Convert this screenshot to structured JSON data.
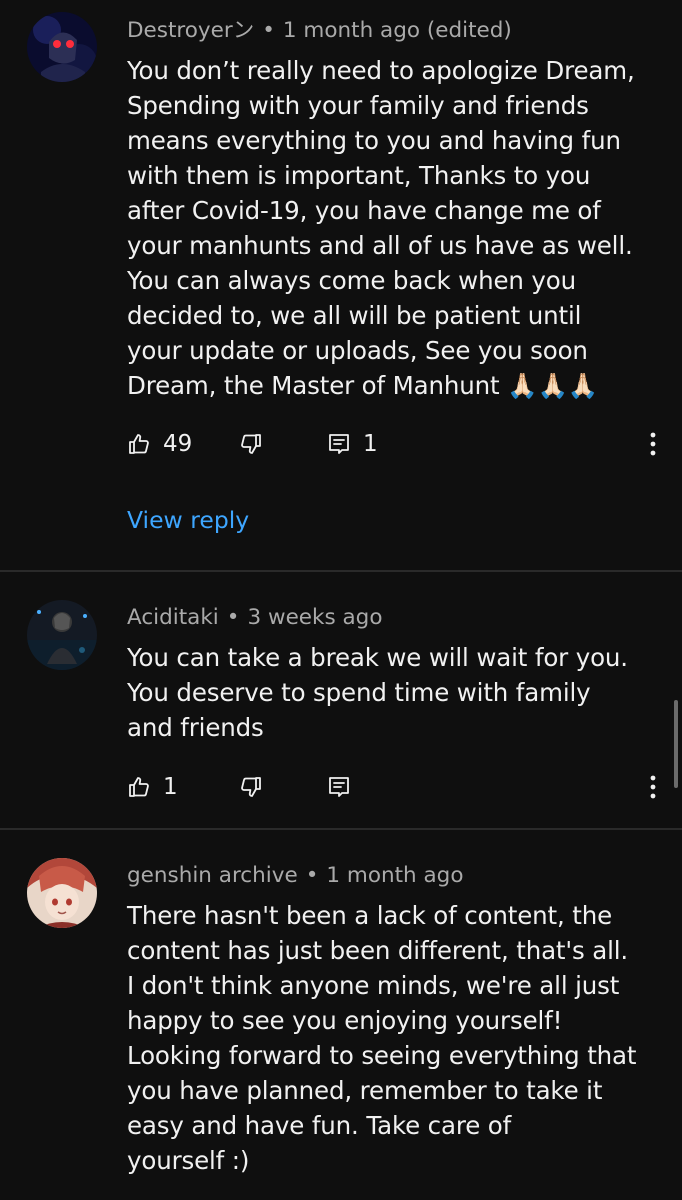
{
  "comments": [
    {
      "author": "Destroyerン",
      "separator": "•",
      "time": "1 month ago (edited)",
      "text": "You don’t really need to apologize Dream,\nSpending with your family and friends\nmeans everything to you and having fun\nwith them is important, Thanks to you\nafter Covid-19, you have change me of\nyour manhunts and all of us have as well.\nYou can always come back when you\ndecided to, we all will be patient until\nyour update or uploads, See you soon\nDream, the Master of Manhunt 🙏🏻🙏🏻🙏🏻",
      "likes": "49",
      "replies": "1",
      "view_reply": "View reply"
    },
    {
      "author": "Aciditaki",
      "separator": "•",
      "time": "3 weeks ago",
      "text": "You can take a break we will wait for you.\nYou deserve to spend time with family\nand friends",
      "likes": "1"
    },
    {
      "author": "genshin archive",
      "separator": "•",
      "time": "1 month ago",
      "text": "There hasn't been a lack of content, the\ncontent has just been different, that's all.\nI don't think anyone minds, we're all just\nhappy to see you enjoying yourself!\nLooking forward to seeing everything that\nyou have planned, remember to take it\neasy and have fun. Take care of\nyourself :)"
    }
  ],
  "colors": {
    "background": "#0f0f0f",
    "meta_text": "#aaaaaa",
    "body_text": "#f1f1f1",
    "link": "#3ea6ff",
    "divider": "#2a2a2a"
  }
}
